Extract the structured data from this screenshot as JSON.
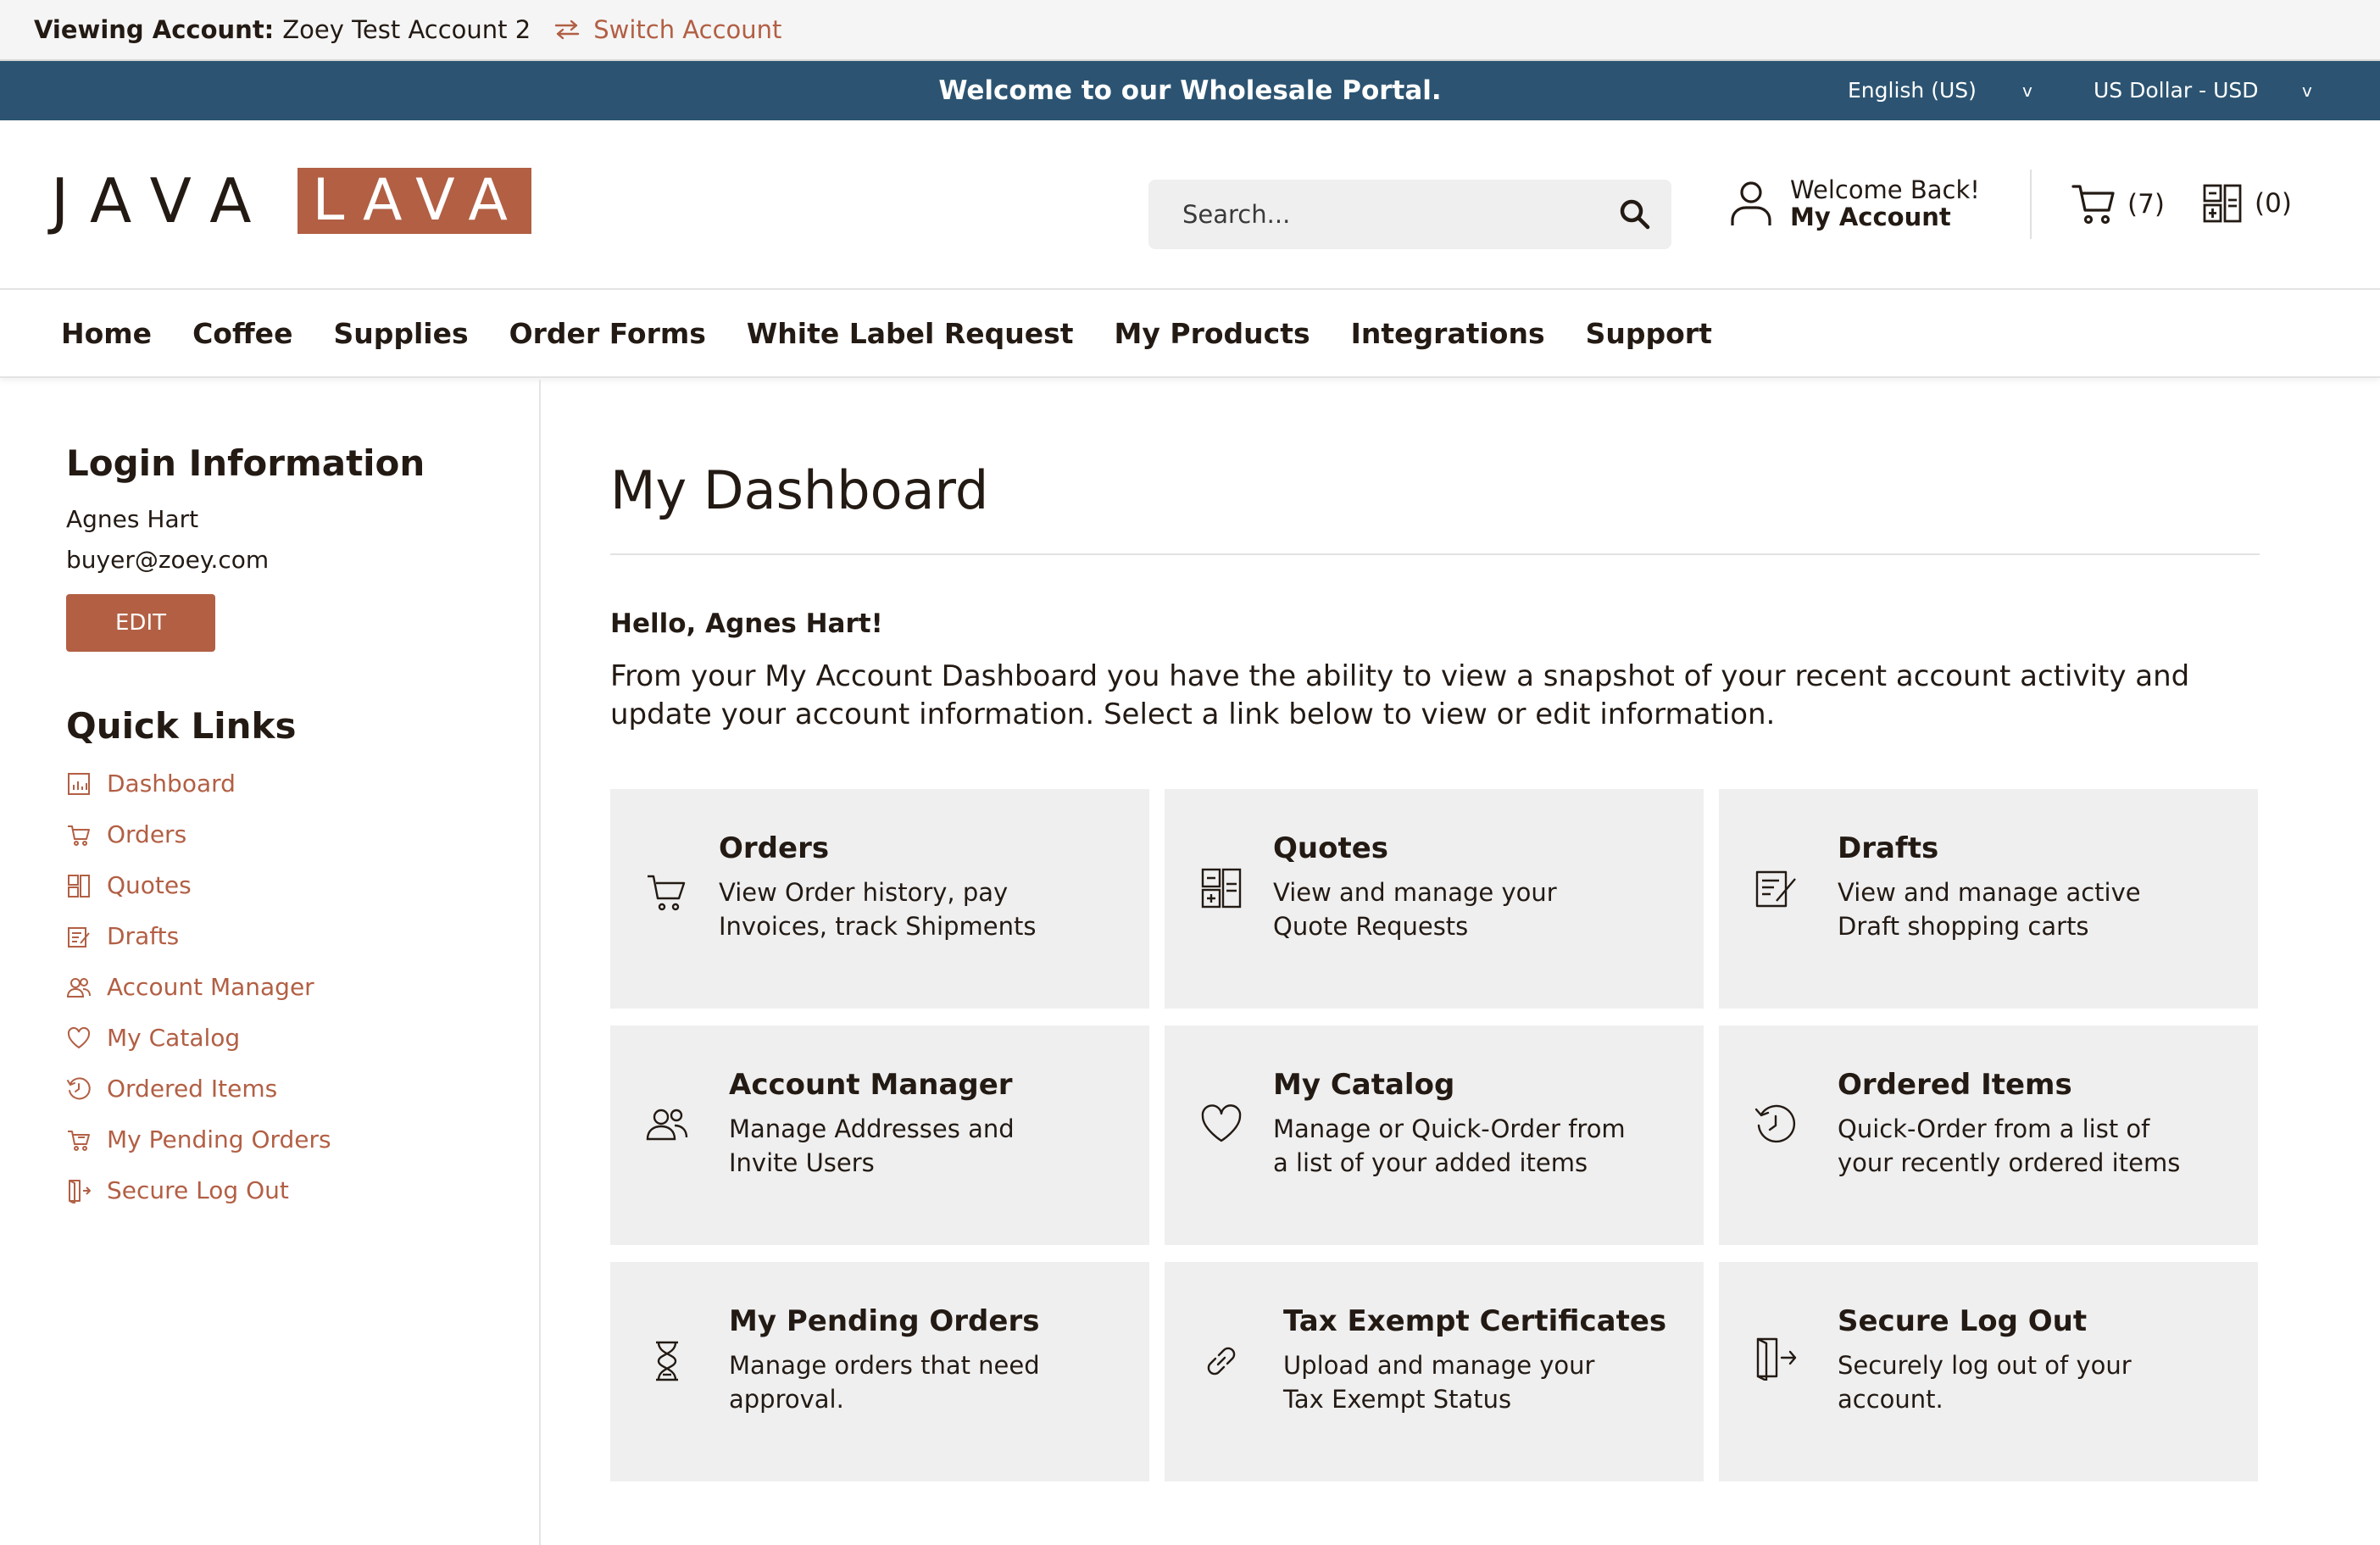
{
  "account_bar": {
    "label": "Viewing Account:",
    "account_name": "Zoey Test Account 2",
    "switch_label": "Switch Account"
  },
  "welcome_strip": {
    "message": "Welcome to our Wholesale Portal.",
    "language": "English (US)",
    "currency": "US Dollar - USD",
    "chevron": "v"
  },
  "header": {
    "logo_left": "JAVA",
    "logo_right": "LAVA",
    "search_placeholder": "Search...",
    "account_greeting": "Welcome Back!",
    "account_link": "My Account",
    "cart_count": "(7)",
    "quote_count": "(0)"
  },
  "nav": [
    "Home",
    "Coffee",
    "Supplies",
    "Order Forms",
    "White Label Request",
    "My Products",
    "Integrations",
    "Support"
  ],
  "sidebar": {
    "login_heading": "Login Information",
    "user_name": "Agnes Hart",
    "user_email": "buyer@zoey.com",
    "edit_label": "EDIT",
    "quick_links_heading": "Quick Links",
    "quick_links": [
      {
        "label": "Dashboard",
        "icon": "dashboard-icon"
      },
      {
        "label": "Orders",
        "icon": "cart-icon"
      },
      {
        "label": "Quotes",
        "icon": "quote-icon"
      },
      {
        "label": "Drafts",
        "icon": "draft-icon"
      },
      {
        "label": "Account Manager",
        "icon": "users-icon"
      },
      {
        "label": "My Catalog",
        "icon": "heart-icon"
      },
      {
        "label": "Ordered Items",
        "icon": "history-icon"
      },
      {
        "label": "My Pending Orders",
        "icon": "pending-cart-icon"
      },
      {
        "label": "Secure Log Out",
        "icon": "logout-icon"
      }
    ]
  },
  "main": {
    "title": "My Dashboard",
    "greeting": "Hello, Agnes Hart!",
    "intro": "From your My Account Dashboard you have the ability to view a snapshot of your recent account activity and update your account information. Select a link below to view or edit information.",
    "cards": [
      {
        "title": "Orders",
        "line1": "View Order history, pay",
        "line2": "Invoices, track Shipments",
        "icon": "cart-icon"
      },
      {
        "title": "Quotes",
        "line1": "View and manage your",
        "line2": "Quote Requests",
        "icon": "quote-icon"
      },
      {
        "title": "Drafts",
        "line1": "View and manage active",
        "line2": "Draft shopping carts",
        "icon": "draft-icon"
      },
      {
        "title": "Account Manager",
        "line1": "Manage Addresses and",
        "line2": "Invite Users",
        "icon": "users-icon"
      },
      {
        "title": "My Catalog",
        "line1": "Manage or Quick-Order from",
        "line2": "a list of your added items",
        "icon": "heart-icon"
      },
      {
        "title": "Ordered Items",
        "line1": "Quick-Order from a list of",
        "line2": "your recently ordered items",
        "icon": "history-icon"
      },
      {
        "title": "My Pending Orders",
        "line1": "Manage orders that need",
        "line2": "approval.",
        "icon": "hourglass-icon"
      },
      {
        "title": "Tax Exempt Certificates",
        "line1": "Upload and manage your",
        "line2": "Tax Exempt Status",
        "icon": "link-icon"
      },
      {
        "title": "Secure Log Out",
        "line1": "Securely log out of your",
        "line2": "account.",
        "icon": "logout-icon"
      }
    ]
  },
  "colors": {
    "accent": "#b25f44",
    "strip": "#2c5472",
    "card_bg": "#efefef",
    "text": "#231a14"
  }
}
